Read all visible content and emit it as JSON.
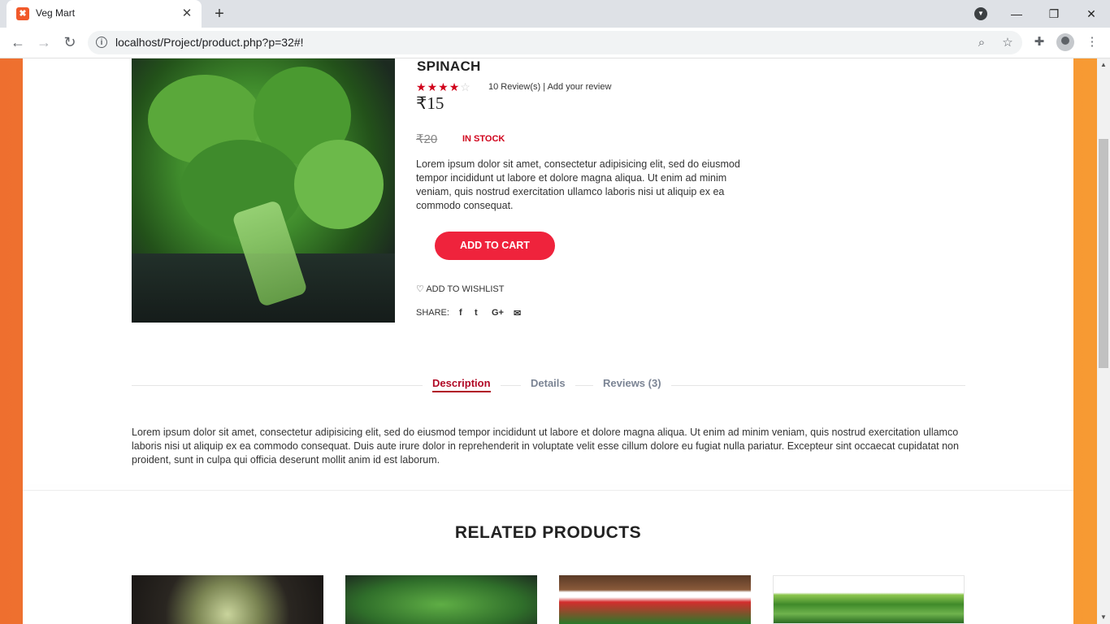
{
  "browser": {
    "tab_title": "Veg Mart",
    "tab_close_glyph": "✕",
    "new_tab_glyph": "+",
    "url": "localhost/Project/product.php?p=32#!",
    "window_controls": {
      "minimize": "—",
      "restore": "❐",
      "close": "✕"
    },
    "icons": [
      "back-arrow-icon",
      "forward-arrow-icon",
      "reload-icon",
      "info-icon",
      "zoom-icon",
      "star-bookmark-icon",
      "extensions-puzzle-icon",
      "profile-icon",
      "kebab-menu-icon"
    ]
  },
  "product": {
    "title": "SPINACH",
    "rating_stars_filled": 4,
    "rating_stars_total": 5,
    "review_count_text": "10 Review(s)",
    "separator": "|",
    "add_review_text": "Add your review",
    "price": "₹15",
    "old_price": "₹20",
    "stock_status": "IN STOCK",
    "description": "Lorem ipsum dolor sit amet, consectetur adipisicing elit, sed do eiusmod tempor incididunt ut labore et dolore magna aliqua. Ut enim ad minim veniam, quis nostrud exercitation ullamco laboris nisi ut aliquip ex ea commodo consequat.",
    "add_to_cart_label": "ADD TO CART",
    "wishlist_label": "ADD TO WISHLIST",
    "share_label": "SHARE:",
    "share_icons": [
      "facebook-icon",
      "twitter-icon",
      "google-plus-icon",
      "email-icon"
    ]
  },
  "tabs": [
    {
      "label": "Description",
      "active": true
    },
    {
      "label": "Details",
      "active": false
    },
    {
      "label": "Reviews (3)",
      "active": false
    }
  ],
  "tab_content": "Lorem ipsum dolor sit amet, consectetur adipisicing elit, sed do eiusmod tempor incididunt ut labore et dolore magna aliqua. Ut enim ad minim veniam, quis nostrud exercitation ullamco laboris nisi ut aliquip ex ea commodo consequat. Duis aute irure dolor in reprehenderit in voluptate velit esse cillum dolore eu fugiat nulla pariatur. Excepteur sint occaecat cupidatat non proident, sunt in culpa qui officia deserunt mollit anim id est laborum.",
  "related": {
    "title": "RELATED PRODUCTS",
    "items": [
      {
        "image": "custard-apple-image"
      },
      {
        "image": "spinach-image"
      },
      {
        "image": "tomato-image"
      },
      {
        "image": "green-beans-image"
      }
    ]
  },
  "colors": {
    "accent_red": "#ef233c",
    "active_tab": "#b10a26",
    "side_gradient_start": "#ee6f2f",
    "side_gradient_end": "#f79a33"
  }
}
